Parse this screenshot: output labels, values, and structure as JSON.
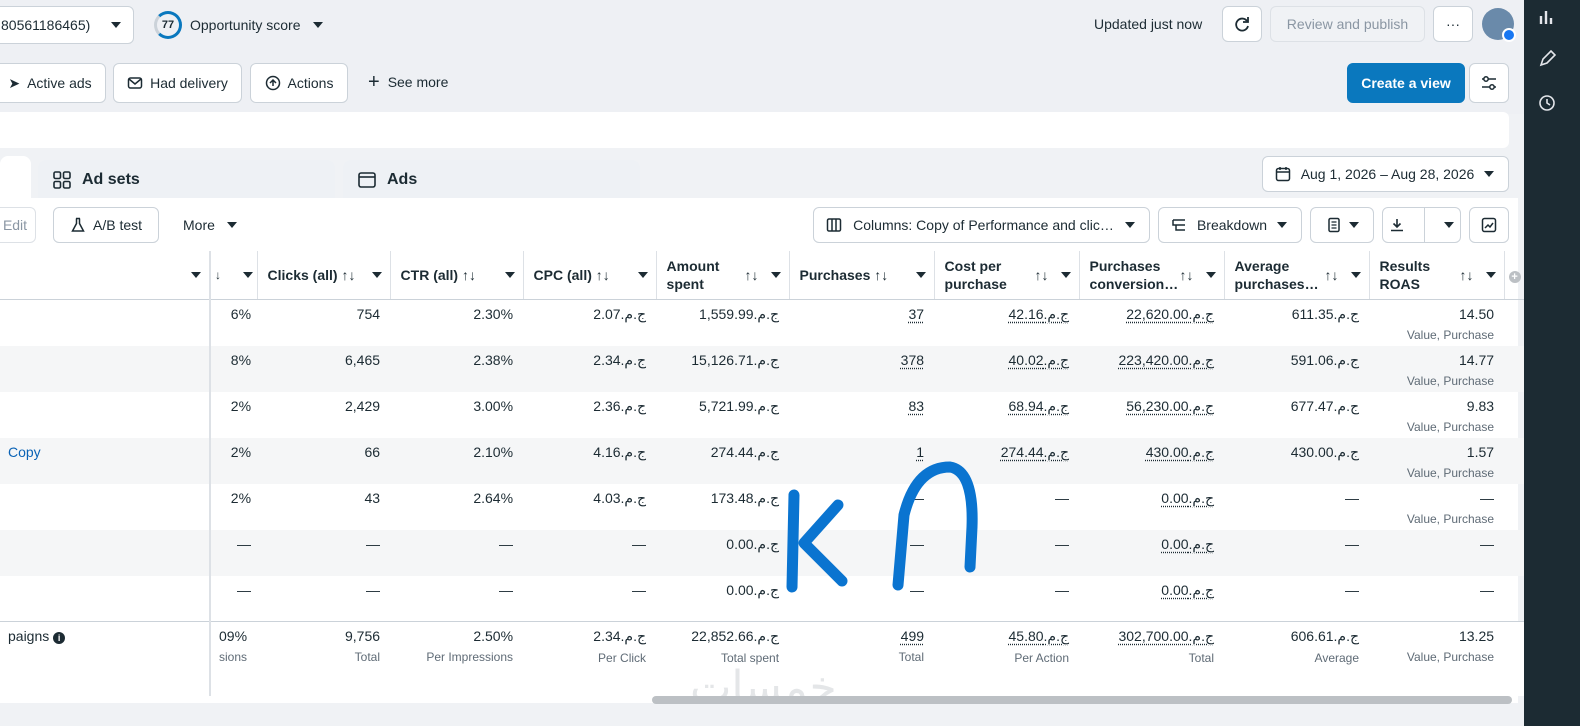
{
  "header": {
    "account_id": "80561186465)",
    "score_value": "77",
    "score_label": "Opportunity score",
    "updated_text": "Updated just now",
    "review_label": "Review and publish",
    "more_label": "···"
  },
  "filters": {
    "active_ads": "Active ads",
    "had_delivery": "Had delivery",
    "actions": "Actions",
    "see_more": "See more",
    "create_view": "Create a view"
  },
  "tabs": {
    "ad_sets": "Ad sets",
    "ads": "Ads"
  },
  "date_range": "Aug 1, 2026 – Aug 28, 2026",
  "toolbar": {
    "edit": "Edit",
    "ab_test": "A/B test",
    "more": "More",
    "columns": "Columns: Copy of Performance and clic…",
    "breakdown": "Breakdown"
  },
  "columns": {
    "clicks": "Clicks (all)",
    "ctr": "CTR (all)",
    "cpc": "CPC (all)",
    "amount_spent": "Amount spent",
    "purchases": "Purchases",
    "cost_per_purchase": "Cost per purchase",
    "purchases_conversion": "Purchases conversion…",
    "avg_purchases": "Average purchases…",
    "results_roas": "Results ROAS",
    "sort_icon": "↑↓"
  },
  "rows": [
    {
      "name": "",
      "pct": "6%",
      "clicks": "754",
      "ctr": "2.30%",
      "cpc": "ج.م.2.07",
      "spent": "ج.م.1,559.99",
      "purchases": "37",
      "cost": "ج.م.42.16",
      "conv": "ج.م.22,620.00",
      "avg": "ج.م.611.35",
      "roas": "14.50",
      "roas_sub": "Value, Purchase"
    },
    {
      "name": "",
      "pct": "8%",
      "clicks": "6,465",
      "ctr": "2.38%",
      "cpc": "ج.م.2.34",
      "spent": "ج.م.15,126.71",
      "purchases": "378",
      "cost": "ج.م.40.02",
      "conv": "ج.م.223,420.00",
      "avg": "ج.م.591.06",
      "roas": "14.77",
      "roas_sub": "Value, Purchase"
    },
    {
      "name": "",
      "pct": "2%",
      "clicks": "2,429",
      "ctr": "3.00%",
      "cpc": "ج.م.2.36",
      "spent": "ج.م.5,721.99",
      "purchases": "83",
      "cost": "ج.م.68.94",
      "conv": "ج.م.56,230.00",
      "avg": "ج.م.677.47",
      "roas": "9.83",
      "roas_sub": "Value, Purchase"
    },
    {
      "name": "Copy",
      "pct": "2%",
      "clicks": "66",
      "ctr": "2.10%",
      "cpc": "ج.م.4.16",
      "spent": "ج.م.274.44",
      "purchases": "1",
      "cost": "ج.م.274.44",
      "conv": "ج.م.430.00",
      "avg": "ج.م.430.00",
      "roas": "1.57",
      "roas_sub": "Value, Purchase"
    },
    {
      "name": "",
      "pct": "2%",
      "clicks": "43",
      "ctr": "2.64%",
      "cpc": "ج.م.4.03",
      "spent": "ج.م.173.48",
      "purchases": "—",
      "cost": "—",
      "conv": "ج.م.0.00",
      "avg": "—",
      "roas": "—",
      "roas_sub": "Value, Purchase"
    },
    {
      "name": "",
      "pct": "—",
      "clicks": "—",
      "ctr": "—",
      "cpc": "—",
      "spent": "ج.م.0.00",
      "purchases": "—",
      "cost": "—",
      "conv": "ج.م.0.00",
      "avg": "—",
      "roas": "—",
      "roas_sub": ""
    },
    {
      "name": "",
      "pct": "—",
      "clicks": "—",
      "ctr": "—",
      "cpc": "—",
      "spent": "ج.م.0.00",
      "purchases": "—",
      "cost": "—",
      "conv": "ج.م.0.00",
      "avg": "—",
      "roas": "—",
      "roas_sub": ""
    }
  ],
  "totals": {
    "name": "paigns",
    "pct": "09%",
    "pct_sub": "sions",
    "clicks": "9,756",
    "clicks_sub": "Total",
    "ctr": "2.50%",
    "ctr_sub": "Per Impressions",
    "cpc": "ج.م.2.34",
    "cpc_sub": "Per Click",
    "spent": "ج.م.22,852.66",
    "spent_sub": "Total spent",
    "purchases": "499",
    "purchases_sub": "Total",
    "cost": "ج.م.45.80",
    "cost_sub": "Per Action",
    "conv": "ج.م.302,700.00",
    "conv_sub": "Total",
    "avg": "ج.م.606.61",
    "avg_sub": "Average",
    "roas": "13.25",
    "roas_sub": "Value, Purchase"
  },
  "handwriting": "KA",
  "watermark": "خمسات"
}
